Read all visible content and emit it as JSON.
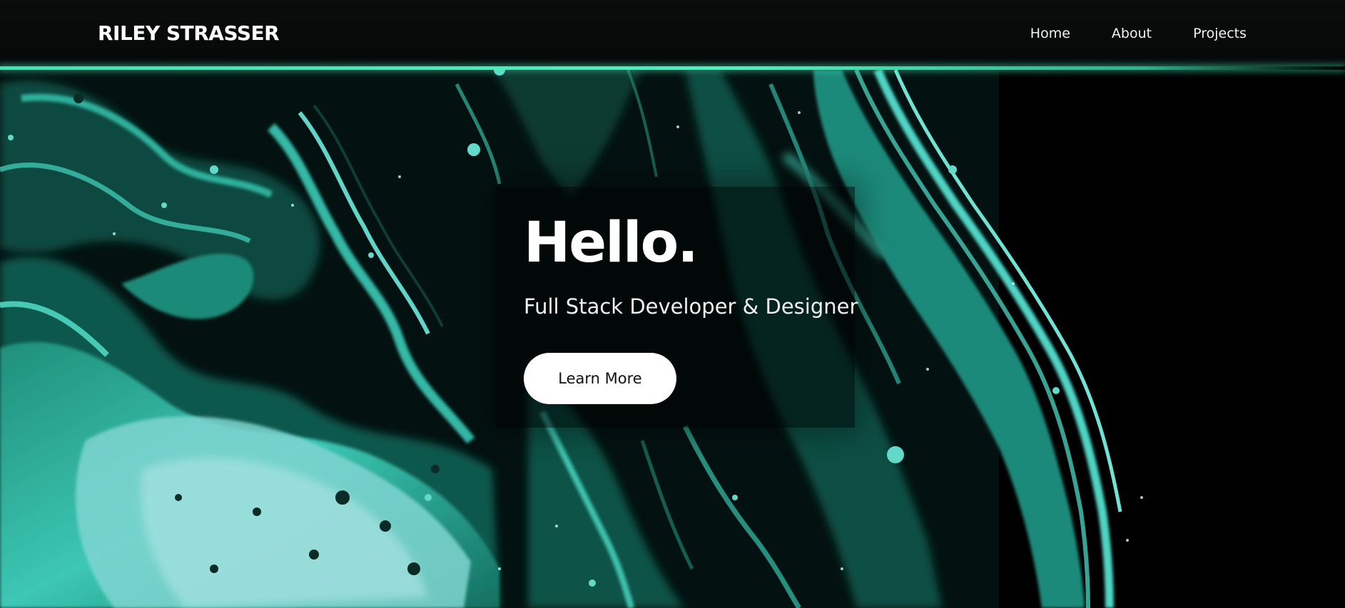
{
  "navbar": {
    "brand": "RILEY STRASSER",
    "links": [
      "Home",
      "About",
      "Projects"
    ]
  },
  "hero": {
    "title": "Hello.",
    "subtitle": "Full Stack Developer & Designer",
    "button_label": "Learn More"
  },
  "colors": {
    "accent": "#3fe3b0",
    "background": "#000000",
    "navbar_bg": "#0b0d0d",
    "button_bg": "#ffffff",
    "text": "#ffffff"
  }
}
